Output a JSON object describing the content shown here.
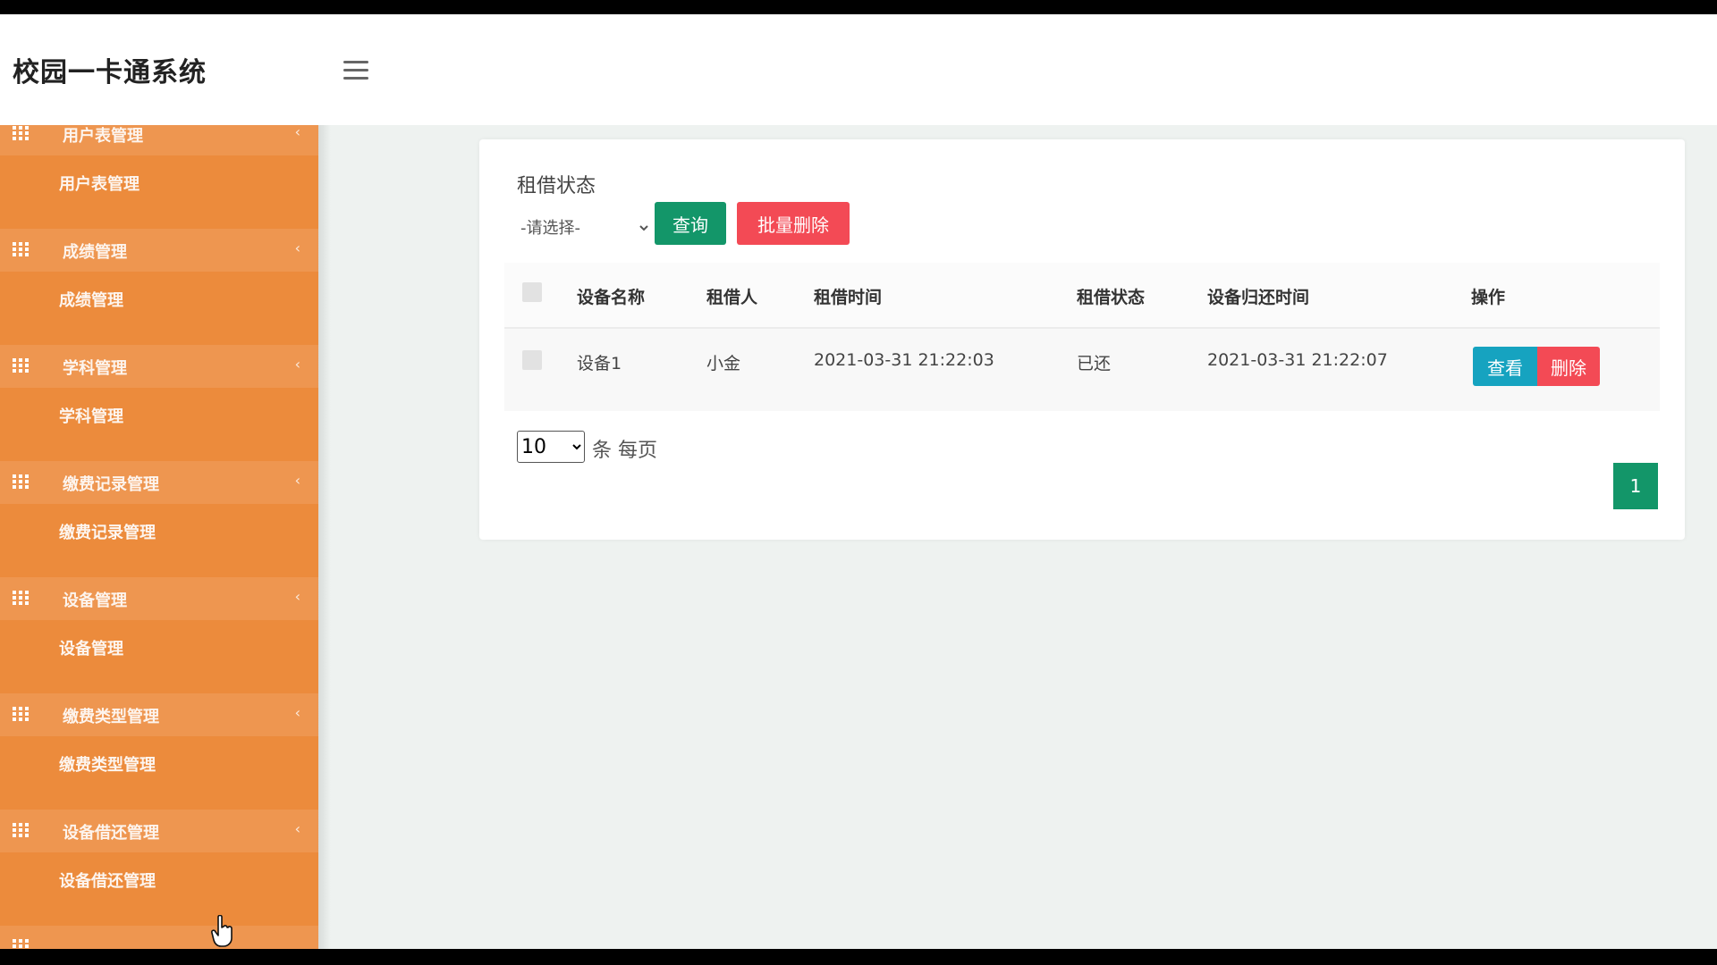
{
  "app": {
    "title": "校园一卡通系统"
  },
  "sidebar": {
    "groups": [
      {
        "head": "用户表管理",
        "item": "用户表管理"
      },
      {
        "head": "成绩管理",
        "item": "成绩管理"
      },
      {
        "head": "学科管理",
        "item": "学科管理"
      },
      {
        "head": "缴费记录管理",
        "item": "缴费记录管理"
      },
      {
        "head": "设备管理",
        "item": "设备管理"
      },
      {
        "head": "缴费类型管理",
        "item": "缴费类型管理"
      },
      {
        "head": "设备借还管理",
        "item": "设备借还管理"
      }
    ]
  },
  "filter": {
    "label": "租借状态",
    "select_value": "-请选择-",
    "query_label": "查询",
    "batch_delete_label": "批量删除"
  },
  "table": {
    "headers": [
      "设备名称",
      "租借人",
      "租借时间",
      "租借状态",
      "设备归还时间",
      "操作"
    ],
    "rows": [
      {
        "device": "设备1",
        "renter": "小金",
        "rent_time": "2021-03-31 21:22:03",
        "status": "已还",
        "return_time": "2021-03-31 21:22:07",
        "view_label": "查看",
        "delete_label": "删除"
      }
    ]
  },
  "pagination": {
    "page_size": "10",
    "page_size_label": "条 每页",
    "current_page": "1"
  },
  "colors": {
    "sidebar": "#ec8b3c",
    "primary_green": "#139669",
    "danger_red": "#f34a55",
    "info_blue": "#16a3c0"
  }
}
